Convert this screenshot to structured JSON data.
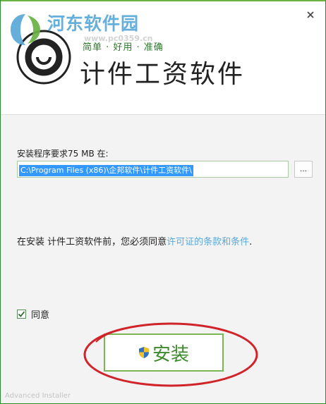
{
  "watermark": {
    "brand": "河东软件园",
    "url": "www.pc0359.cn"
  },
  "header": {
    "tagline": "简单 · 好用 · 准确",
    "app_title": "计件工资软件"
  },
  "install_path": {
    "label": "安装程序要求75 MB 在:",
    "value": "C:\\Program Files (x86)\\企邦软件\\计件工资软件\\",
    "browse_label": "..."
  },
  "license": {
    "prefix": "在安装 计件工资软件前，您必须同意",
    "link": "许可证的条款和条件",
    "suffix": "."
  },
  "agree": {
    "label": "同意",
    "checked": true
  },
  "install_button": {
    "label": "安装"
  },
  "footer": {
    "text": "Advanced Installer"
  },
  "colors": {
    "accent_green": "#3d8a2c",
    "link_blue": "#5aa9d9",
    "selection_blue": "#3399ff",
    "annotation_red": "#d0232a"
  },
  "icons": [
    "close-icon",
    "app-logo-icon",
    "watermark-logo-icon",
    "shield-icon",
    "checkmark-icon"
  ]
}
